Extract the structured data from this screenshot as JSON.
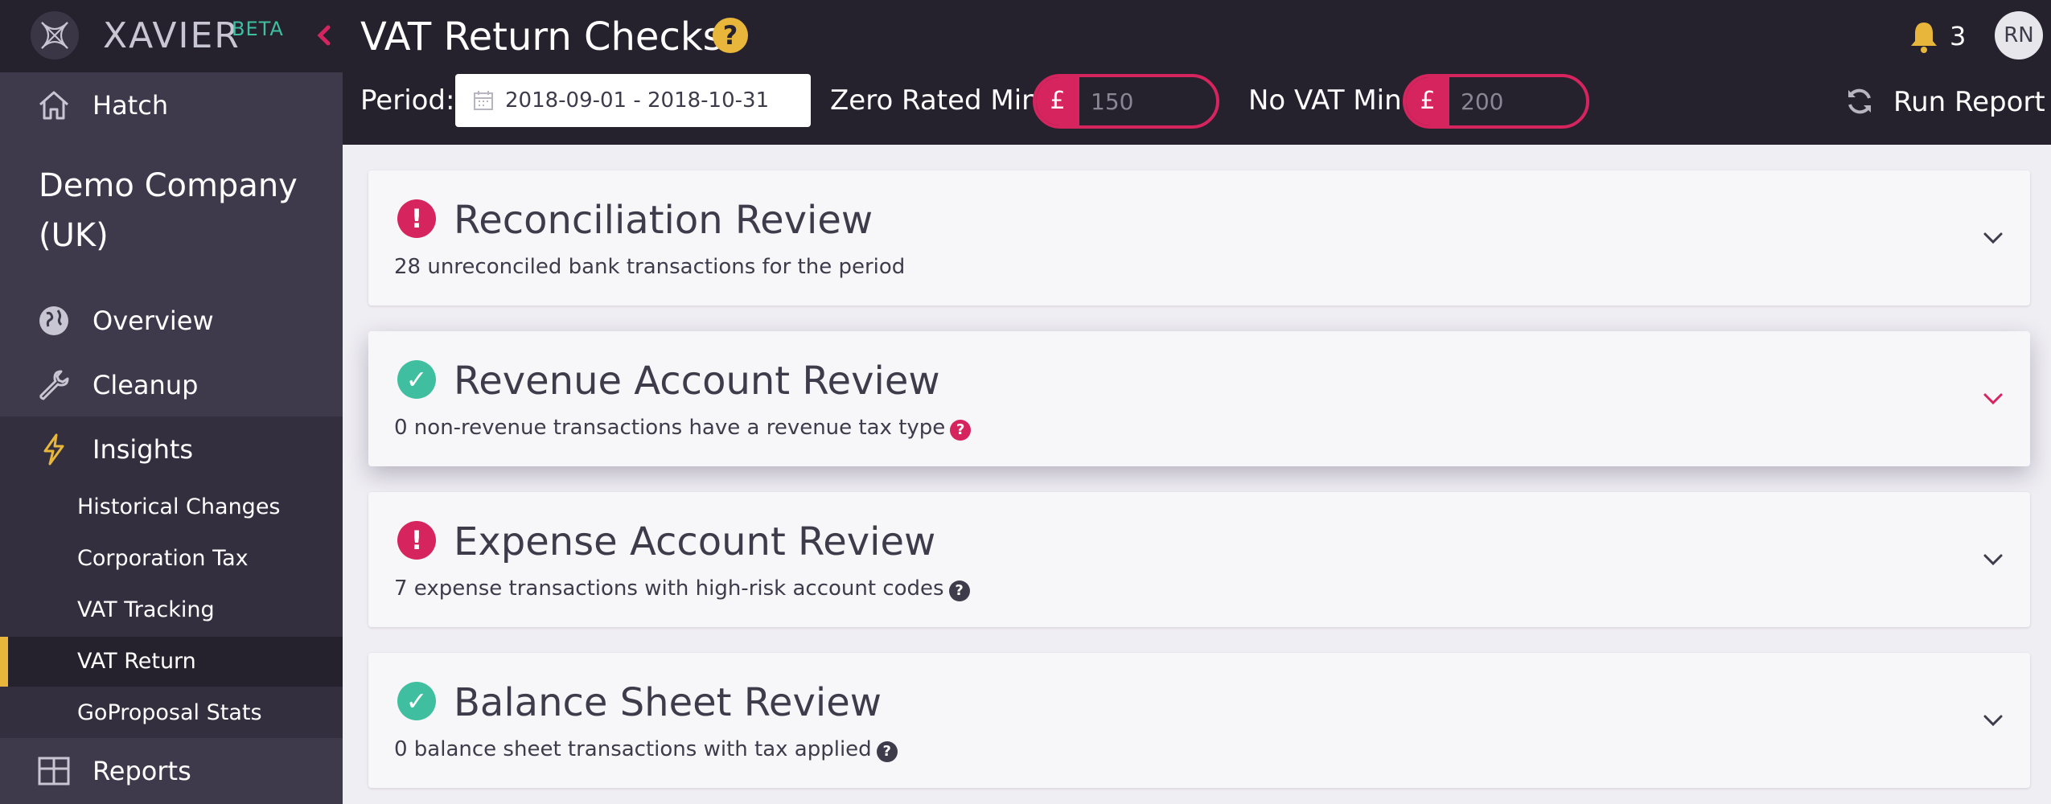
{
  "brand": {
    "name": "XAVIER",
    "badge": "BETA"
  },
  "sidebar": {
    "hatch": "Hatch",
    "company": "Demo Company (UK)",
    "overview": "Overview",
    "cleanup": "Cleanup",
    "insights": "Insights",
    "insights_items": [
      "Historical Changes",
      "Corporation Tax",
      "VAT Tracking",
      "VAT Return",
      "GoProposal Stats"
    ],
    "active_item": "VAT Return",
    "reports": "Reports"
  },
  "header": {
    "title": "VAT Return Checks",
    "help_glyph": "?",
    "notifications": "3",
    "avatar_initials": "RN",
    "period_label": "Period:",
    "period_value": "2018-09-01  -  2018-10-31",
    "zero_rated_label": "Zero Rated Min",
    "zero_rated_currency": "£",
    "zero_rated_value": "150",
    "no_vat_label": "No VAT Min",
    "no_vat_currency": "£",
    "no_vat_value": "200",
    "run_report": "Run Report"
  },
  "cards": [
    {
      "title": "Reconciliation Review",
      "status": "error",
      "status_glyph": "!",
      "subtitle": "28 unreconciled bank transactions for the period",
      "help": "",
      "expanded": false
    },
    {
      "title": "Revenue Account Review",
      "status": "ok",
      "status_glyph": "✓",
      "subtitle": "0 non-revenue transactions have a revenue tax type",
      "help": "?",
      "help_color": "#d6245e",
      "expanded": true
    },
    {
      "title": "Expense Account Review",
      "status": "error",
      "status_glyph": "!",
      "subtitle": "7 expense transactions with high-risk account codes",
      "help": "?",
      "help_color": "#3e3b4a",
      "expanded": false
    },
    {
      "title": "Balance Sheet Review",
      "status": "ok",
      "status_glyph": "✓",
      "subtitle": "0 balance sheet transactions with tax applied",
      "help": "?",
      "help_color": "#3e3b4a",
      "expanded": false
    }
  ],
  "colors": {
    "accent_pink": "#d6245e",
    "accent_yellow": "#e8b63a",
    "success_green": "#3fbf9f",
    "sidebar_bg": "#3e3a4b",
    "topbar_bg": "#25222e"
  },
  "icons": {
    "hatch": "home-icon",
    "overview": "globe-icon",
    "cleanup": "wrench-icon",
    "insights": "lightning-icon",
    "reports": "table-grid-icon",
    "notifications": "bell-icon",
    "run_report": "refresh-icon",
    "period": "calendar-icon",
    "card_toggle": "chevron-down-icon"
  }
}
